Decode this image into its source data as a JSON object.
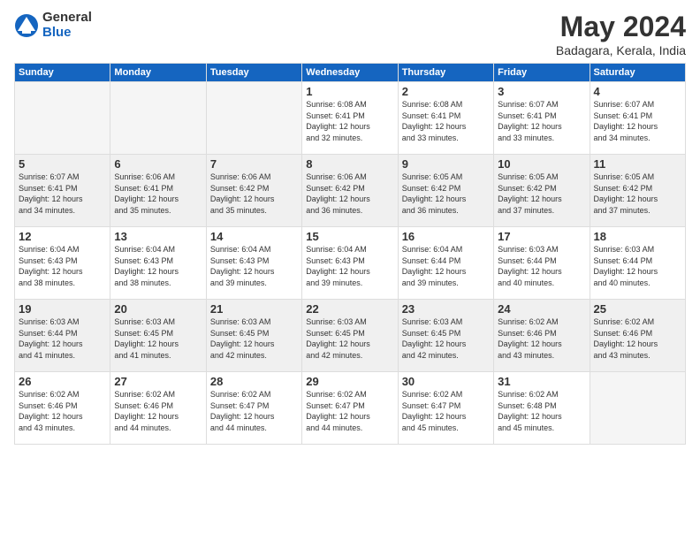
{
  "logo": {
    "general": "General",
    "blue": "Blue"
  },
  "title": "May 2024",
  "location": "Badagara, Kerala, India",
  "days_header": [
    "Sunday",
    "Monday",
    "Tuesday",
    "Wednesday",
    "Thursday",
    "Friday",
    "Saturday"
  ],
  "weeks": [
    {
      "shaded": false,
      "days": [
        {
          "num": "",
          "info": ""
        },
        {
          "num": "",
          "info": ""
        },
        {
          "num": "",
          "info": ""
        },
        {
          "num": "1",
          "info": "Sunrise: 6:08 AM\nSunset: 6:41 PM\nDaylight: 12 hours\nand 32 minutes."
        },
        {
          "num": "2",
          "info": "Sunrise: 6:08 AM\nSunset: 6:41 PM\nDaylight: 12 hours\nand 33 minutes."
        },
        {
          "num": "3",
          "info": "Sunrise: 6:07 AM\nSunset: 6:41 PM\nDaylight: 12 hours\nand 33 minutes."
        },
        {
          "num": "4",
          "info": "Sunrise: 6:07 AM\nSunset: 6:41 PM\nDaylight: 12 hours\nand 34 minutes."
        }
      ]
    },
    {
      "shaded": true,
      "days": [
        {
          "num": "5",
          "info": "Sunrise: 6:07 AM\nSunset: 6:41 PM\nDaylight: 12 hours\nand 34 minutes."
        },
        {
          "num": "6",
          "info": "Sunrise: 6:06 AM\nSunset: 6:41 PM\nDaylight: 12 hours\nand 35 minutes."
        },
        {
          "num": "7",
          "info": "Sunrise: 6:06 AM\nSunset: 6:42 PM\nDaylight: 12 hours\nand 35 minutes."
        },
        {
          "num": "8",
          "info": "Sunrise: 6:06 AM\nSunset: 6:42 PM\nDaylight: 12 hours\nand 36 minutes."
        },
        {
          "num": "9",
          "info": "Sunrise: 6:05 AM\nSunset: 6:42 PM\nDaylight: 12 hours\nand 36 minutes."
        },
        {
          "num": "10",
          "info": "Sunrise: 6:05 AM\nSunset: 6:42 PM\nDaylight: 12 hours\nand 37 minutes."
        },
        {
          "num": "11",
          "info": "Sunrise: 6:05 AM\nSunset: 6:42 PM\nDaylight: 12 hours\nand 37 minutes."
        }
      ]
    },
    {
      "shaded": false,
      "days": [
        {
          "num": "12",
          "info": "Sunrise: 6:04 AM\nSunset: 6:43 PM\nDaylight: 12 hours\nand 38 minutes."
        },
        {
          "num": "13",
          "info": "Sunrise: 6:04 AM\nSunset: 6:43 PM\nDaylight: 12 hours\nand 38 minutes."
        },
        {
          "num": "14",
          "info": "Sunrise: 6:04 AM\nSunset: 6:43 PM\nDaylight: 12 hours\nand 39 minutes."
        },
        {
          "num": "15",
          "info": "Sunrise: 6:04 AM\nSunset: 6:43 PM\nDaylight: 12 hours\nand 39 minutes."
        },
        {
          "num": "16",
          "info": "Sunrise: 6:04 AM\nSunset: 6:44 PM\nDaylight: 12 hours\nand 39 minutes."
        },
        {
          "num": "17",
          "info": "Sunrise: 6:03 AM\nSunset: 6:44 PM\nDaylight: 12 hours\nand 40 minutes."
        },
        {
          "num": "18",
          "info": "Sunrise: 6:03 AM\nSunset: 6:44 PM\nDaylight: 12 hours\nand 40 minutes."
        }
      ]
    },
    {
      "shaded": true,
      "days": [
        {
          "num": "19",
          "info": "Sunrise: 6:03 AM\nSunset: 6:44 PM\nDaylight: 12 hours\nand 41 minutes."
        },
        {
          "num": "20",
          "info": "Sunrise: 6:03 AM\nSunset: 6:45 PM\nDaylight: 12 hours\nand 41 minutes."
        },
        {
          "num": "21",
          "info": "Sunrise: 6:03 AM\nSunset: 6:45 PM\nDaylight: 12 hours\nand 42 minutes."
        },
        {
          "num": "22",
          "info": "Sunrise: 6:03 AM\nSunset: 6:45 PM\nDaylight: 12 hours\nand 42 minutes."
        },
        {
          "num": "23",
          "info": "Sunrise: 6:03 AM\nSunset: 6:45 PM\nDaylight: 12 hours\nand 42 minutes."
        },
        {
          "num": "24",
          "info": "Sunrise: 6:02 AM\nSunset: 6:46 PM\nDaylight: 12 hours\nand 43 minutes."
        },
        {
          "num": "25",
          "info": "Sunrise: 6:02 AM\nSunset: 6:46 PM\nDaylight: 12 hours\nand 43 minutes."
        }
      ]
    },
    {
      "shaded": false,
      "days": [
        {
          "num": "26",
          "info": "Sunrise: 6:02 AM\nSunset: 6:46 PM\nDaylight: 12 hours\nand 43 minutes."
        },
        {
          "num": "27",
          "info": "Sunrise: 6:02 AM\nSunset: 6:46 PM\nDaylight: 12 hours\nand 44 minutes."
        },
        {
          "num": "28",
          "info": "Sunrise: 6:02 AM\nSunset: 6:47 PM\nDaylight: 12 hours\nand 44 minutes."
        },
        {
          "num": "29",
          "info": "Sunrise: 6:02 AM\nSunset: 6:47 PM\nDaylight: 12 hours\nand 44 minutes."
        },
        {
          "num": "30",
          "info": "Sunrise: 6:02 AM\nSunset: 6:47 PM\nDaylight: 12 hours\nand 45 minutes."
        },
        {
          "num": "31",
          "info": "Sunrise: 6:02 AM\nSunset: 6:48 PM\nDaylight: 12 hours\nand 45 minutes."
        },
        {
          "num": "",
          "info": ""
        }
      ]
    }
  ]
}
